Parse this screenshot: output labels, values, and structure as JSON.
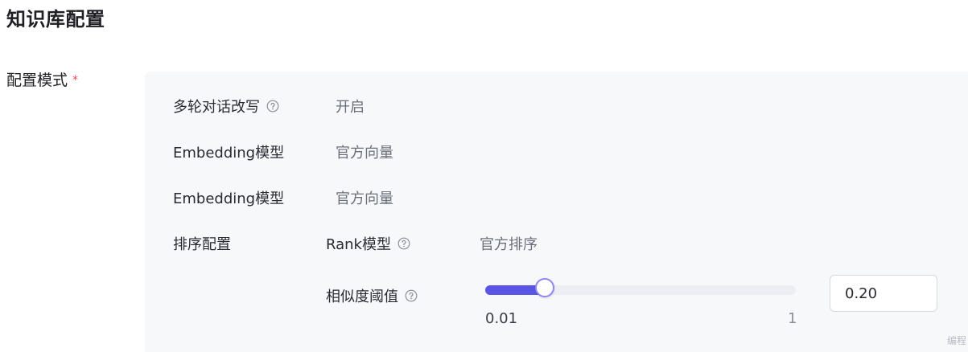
{
  "page_title": "知识库配置",
  "config_mode": {
    "label": "配置模式",
    "required_mark": "*"
  },
  "rows": {
    "multi_turn": {
      "label": "多轮对话改写",
      "value": "开启",
      "help_icon": "question-circle-icon"
    },
    "embedding_1": {
      "label": "Embedding模型",
      "value": "官方向量"
    },
    "embedding_2": {
      "label": "Embedding模型",
      "value": "官方向量"
    },
    "rank": {
      "section_label": "排序配置",
      "model_label": "Rank模型",
      "model_value": "官方排序",
      "help_icon": "question-circle-icon"
    },
    "similarity": {
      "label": "相似度阈值",
      "help_icon": "question-circle-icon",
      "min_label": "0.01",
      "max_label": "1",
      "min": 0.01,
      "max": 1,
      "value": 0.2,
      "input_value": "0.20"
    }
  },
  "watermark": "编程",
  "colors": {
    "accent": "#5b55e6",
    "required": "#f04848",
    "panel_bg": "#f7f8fa"
  }
}
